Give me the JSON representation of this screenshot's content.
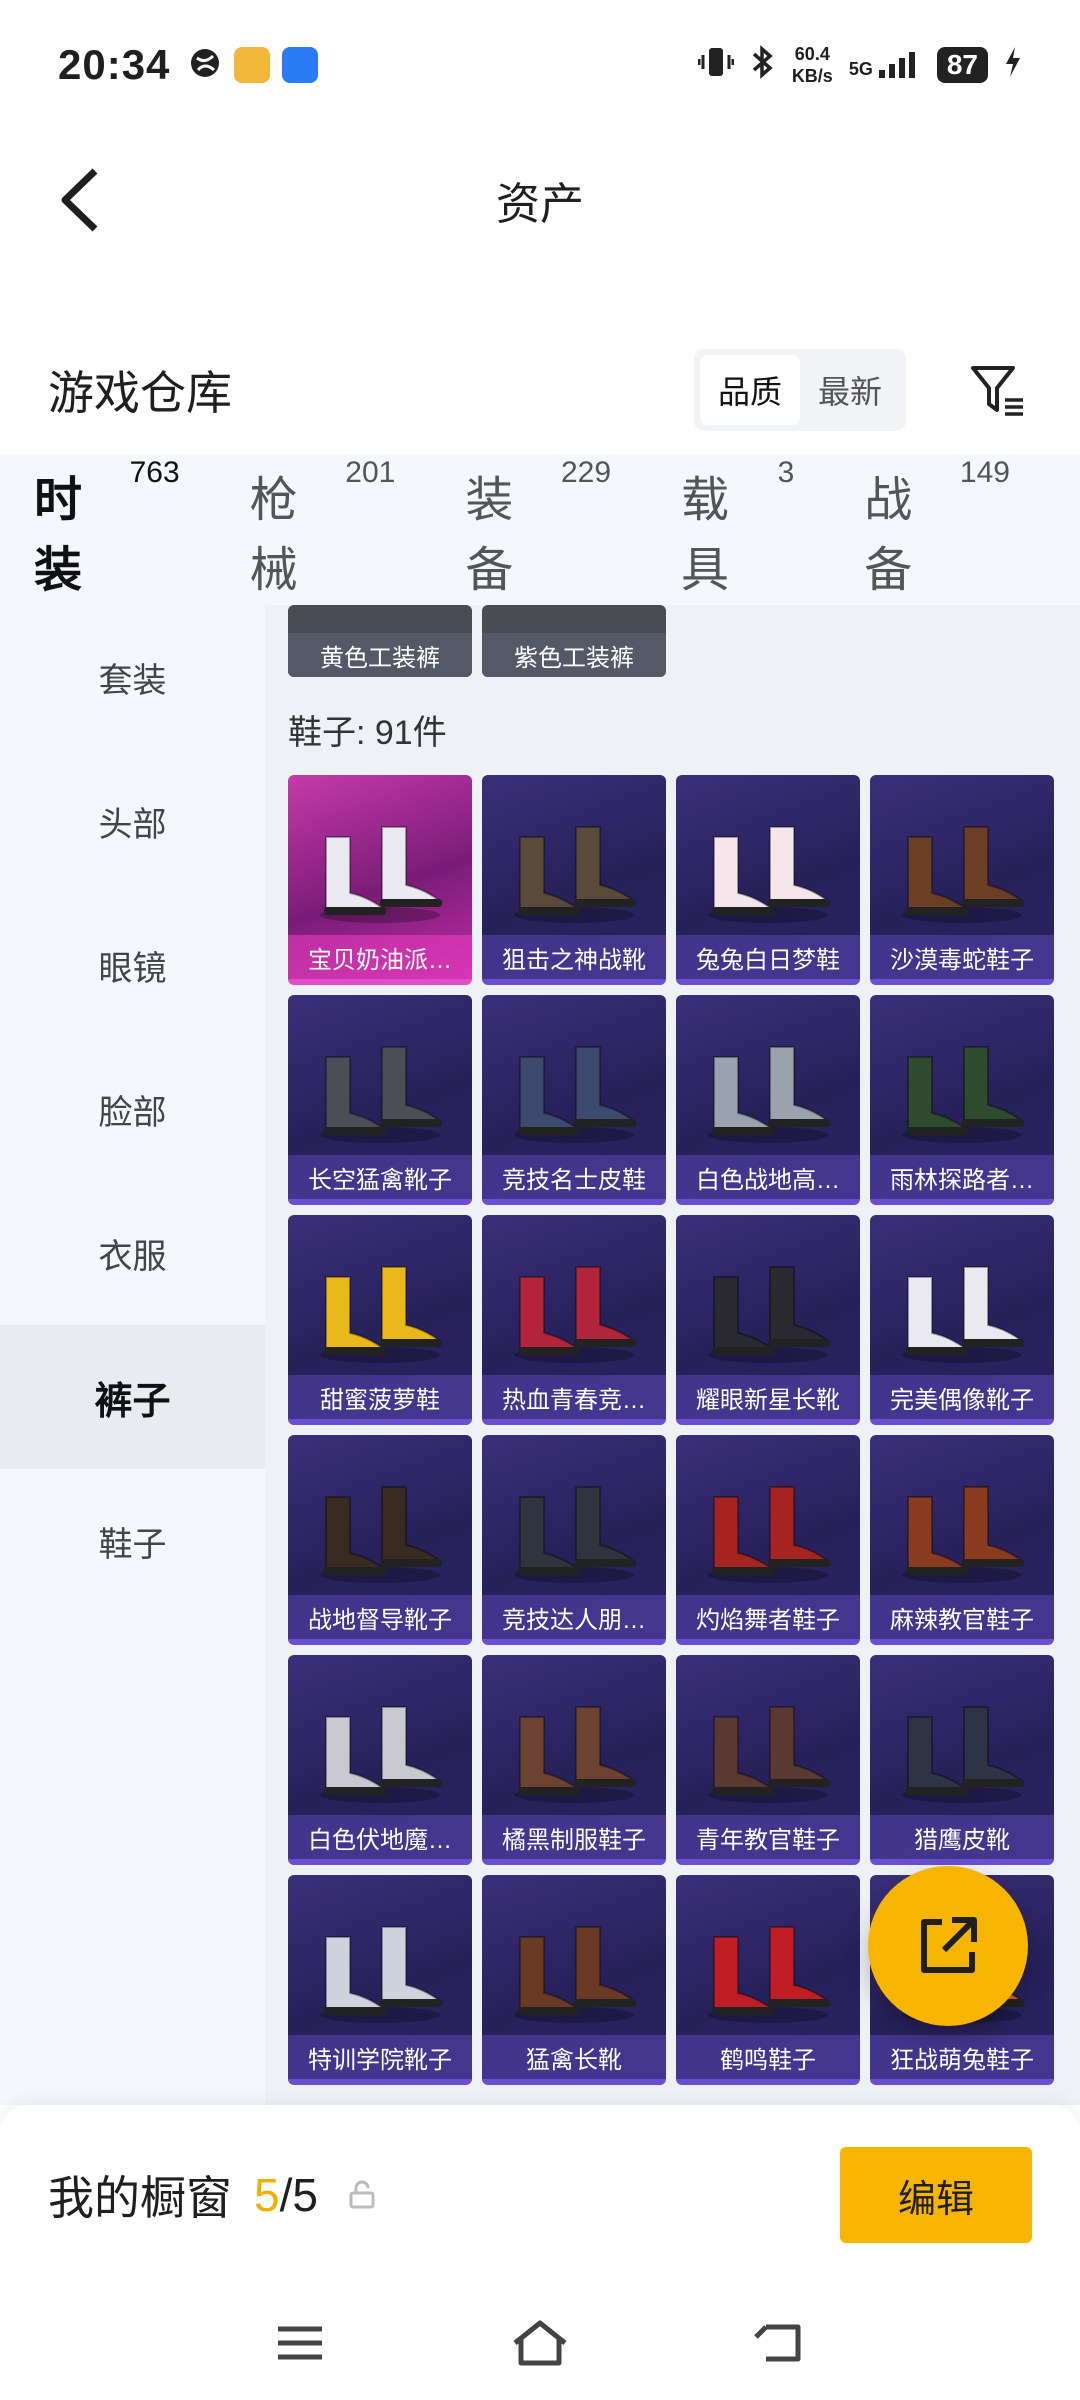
{
  "status_bar": {
    "time": "20:34",
    "network_speed": "60.4",
    "network_unit": "KB/s",
    "signal": "5G",
    "battery": "87"
  },
  "nav": {
    "title": "资产"
  },
  "warehouse": {
    "title": "游戏仓库",
    "sort_options": [
      "品质",
      "最新"
    ],
    "sort_selected": "品质"
  },
  "categories": [
    {
      "label": "时装",
      "count": "763",
      "active": true
    },
    {
      "label": "枪械",
      "count": "201",
      "active": false
    },
    {
      "label": "装备",
      "count": "229",
      "active": false
    },
    {
      "label": "载具",
      "count": "3",
      "active": false
    },
    {
      "label": "战备",
      "count": "149",
      "active": false
    }
  ],
  "sidenav": [
    {
      "label": "套装",
      "active": false
    },
    {
      "label": "头部",
      "active": false
    },
    {
      "label": "眼镜",
      "active": false
    },
    {
      "label": "脸部",
      "active": false
    },
    {
      "label": "衣服",
      "active": false
    },
    {
      "label": "裤子",
      "active": true
    },
    {
      "label": "鞋子",
      "active": false
    }
  ],
  "pants_tail": [
    "黄色工装裤",
    "紫色工装裤"
  ],
  "shoes_section": {
    "label": "鞋子: 91件"
  },
  "shoes": [
    {
      "name": "宝贝奶油派…",
      "rarity": "legendary",
      "color": "#e9e9ef"
    },
    {
      "name": "狙击之神战靴",
      "rarity": "epic",
      "color": "#5a4a3a"
    },
    {
      "name": "兔兔白日梦鞋",
      "rarity": "epic",
      "color": "#f4e6ea"
    },
    {
      "name": "沙漠毒蛇鞋子",
      "rarity": "epic",
      "color": "#6b3e26"
    },
    {
      "name": "长空猛禽靴子",
      "rarity": "epic",
      "color": "#4d4d55"
    },
    {
      "name": "竞技名士皮鞋",
      "rarity": "epic",
      "color": "#3c4a6e"
    },
    {
      "name": "白色战地高…",
      "rarity": "epic",
      "color": "#9aa2ad"
    },
    {
      "name": "雨林探路者…",
      "rarity": "epic",
      "color": "#2f4b2e"
    },
    {
      "name": "甜蜜菠萝鞋",
      "rarity": "epic",
      "color": "#e9b81a"
    },
    {
      "name": "热血青春竞…",
      "rarity": "epic",
      "color": "#b3243a"
    },
    {
      "name": "耀眼新星长靴",
      "rarity": "epic",
      "color": "#2a2a30"
    },
    {
      "name": "完美偶像靴子",
      "rarity": "epic",
      "color": "#e9e9ef"
    },
    {
      "name": "战地督导靴子",
      "rarity": "epic",
      "color": "#3a2b22"
    },
    {
      "name": "竞技达人朋…",
      "rarity": "epic",
      "color": "#30343d"
    },
    {
      "name": "灼焰舞者鞋子",
      "rarity": "epic",
      "color": "#a62420"
    },
    {
      "name": "麻辣教官鞋子",
      "rarity": "epic",
      "color": "#8a3a1e"
    },
    {
      "name": "白色伏地魔…",
      "rarity": "epic",
      "color": "#c9c9cf"
    },
    {
      "name": "橘黑制服鞋子",
      "rarity": "epic",
      "color": "#6b4330"
    },
    {
      "name": "青年教官鞋子",
      "rarity": "epic",
      "color": "#5a3a30"
    },
    {
      "name": "猎鹰皮靴",
      "rarity": "epic",
      "color": "#2e3445"
    },
    {
      "name": "特训学院靴子",
      "rarity": "epic",
      "color": "#cfd3de"
    },
    {
      "name": "猛禽长靴",
      "rarity": "epic",
      "color": "#6b3a24"
    },
    {
      "name": "鹤鸣鞋子",
      "rarity": "epic",
      "color": "#c01e24"
    },
    {
      "name": "狂战萌兔鞋子",
      "rarity": "epic",
      "color": "#e7662a"
    }
  ],
  "showcase": {
    "title": "我的橱窗",
    "current": "5",
    "total": "/5",
    "edit_label": "编辑"
  },
  "colors": {
    "accent": "#f7b500",
    "card_epic": "#2b2366",
    "card_legendary": "#b92c9f"
  }
}
